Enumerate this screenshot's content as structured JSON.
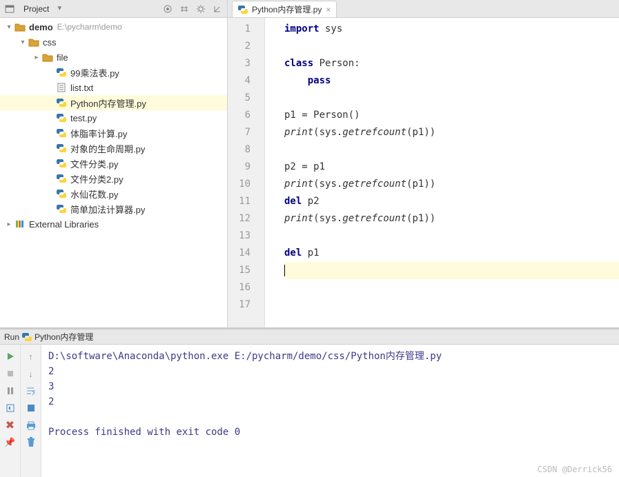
{
  "project_panel": {
    "title": "Project",
    "root": {
      "label": "demo",
      "path": "E:\\pycharm\\demo"
    },
    "css_folder": "css",
    "file_folder": "file",
    "files": [
      "99乘法表.py",
      "list.txt",
      "Python内存管理.py",
      "test.py",
      "体脂率计算.py",
      "对象的生命周期.py",
      "文件分类.py",
      "文件分类2.py",
      "水仙花数.py",
      "简单加法计算器.py"
    ],
    "external": "External Libraries"
  },
  "editor": {
    "tab_label": "Python内存管理.py",
    "lines": [
      {
        "n": 1,
        "tokens": [
          [
            "kw",
            "import"
          ],
          [
            "",
            " sys"
          ]
        ]
      },
      {
        "n": 2,
        "tokens": []
      },
      {
        "n": 3,
        "tokens": [
          [
            "kw",
            "class"
          ],
          [
            "",
            " Person:"
          ]
        ]
      },
      {
        "n": 4,
        "tokens": [
          [
            "",
            "    "
          ],
          [
            "kw",
            "pass"
          ]
        ]
      },
      {
        "n": 5,
        "tokens": []
      },
      {
        "n": 6,
        "tokens": [
          [
            "",
            "p1 = Person()"
          ]
        ]
      },
      {
        "n": 7,
        "tokens": [
          [
            "fn",
            "print"
          ],
          [
            "",
            "(sys."
          ],
          [
            "fn",
            "getrefcount"
          ],
          [
            "",
            "(p1))"
          ]
        ]
      },
      {
        "n": 8,
        "tokens": []
      },
      {
        "n": 9,
        "tokens": [
          [
            "",
            "p2 = p1"
          ]
        ]
      },
      {
        "n": 10,
        "tokens": [
          [
            "fn",
            "print"
          ],
          [
            "",
            "(sys."
          ],
          [
            "fn",
            "getrefcount"
          ],
          [
            "",
            "(p1))"
          ]
        ]
      },
      {
        "n": 11,
        "tokens": [
          [
            "kw",
            "del"
          ],
          [
            "",
            " p2"
          ]
        ]
      },
      {
        "n": 12,
        "tokens": [
          [
            "fn",
            "print"
          ],
          [
            "",
            "(sys."
          ],
          [
            "fn",
            "getrefcount"
          ],
          [
            "",
            "(p1))"
          ]
        ]
      },
      {
        "n": 13,
        "tokens": []
      },
      {
        "n": 14,
        "tokens": [
          [
            "kw",
            "del"
          ],
          [
            "",
            " p1"
          ]
        ]
      },
      {
        "n": 15,
        "tokens": [],
        "current": true
      },
      {
        "n": 16,
        "tokens": []
      },
      {
        "n": 17,
        "tokens": []
      }
    ]
  },
  "run": {
    "title_prefix": "Run",
    "config_name": "Python内存管理",
    "output": [
      "D:\\software\\Anaconda\\python.exe E:/pycharm/demo/css/Python内存管理.py",
      "2",
      "3",
      "2",
      "",
      "Process finished with exit code 0"
    ]
  },
  "watermark": "CSDN @Derrick56"
}
